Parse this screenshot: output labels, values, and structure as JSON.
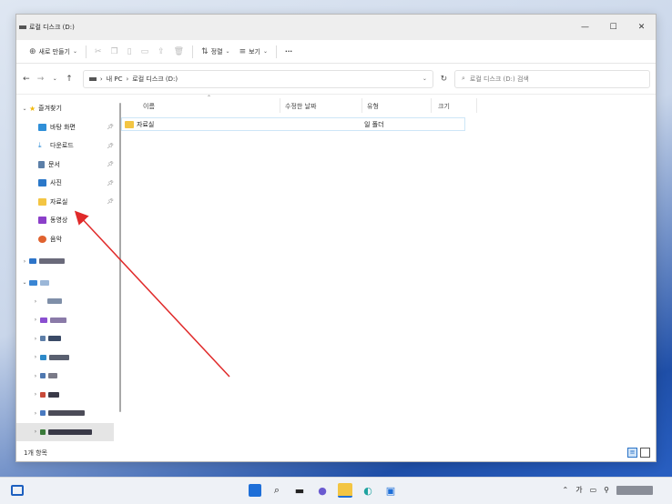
{
  "window": {
    "title": "로컬 디스크 (D:)",
    "controls": {
      "minimize": "—",
      "maximize": "☐",
      "close": "✕"
    }
  },
  "toolbar": {
    "new_label": "새로 만들기",
    "sort_label": "정렬",
    "view_label": "보기",
    "more_label": "···"
  },
  "address": {
    "path_root": "내 PC",
    "path_current": "로컬 디스크 (D:)",
    "search_placeholder": "로컬 디스크 (D:) 검색"
  },
  "sidebar": {
    "quick_access": "즐겨찾기",
    "items": [
      {
        "label": "바탕 화면",
        "icon": "desktop-icon",
        "color": "#2f8fd8"
      },
      {
        "label": "다운로드",
        "icon": "download-icon",
        "color": "#2a8ad6"
      },
      {
        "label": "문서",
        "icon": "documents-icon",
        "color": "#5c7fa8"
      },
      {
        "label": "사진",
        "icon": "pictures-icon",
        "color": "#2b78c9"
      },
      {
        "label": "자료실",
        "icon": "folder-icon",
        "color": "#f3c543"
      },
      {
        "label": "동영상",
        "icon": "videos-icon",
        "color": "#8b3fc9"
      },
      {
        "label": "음악",
        "icon": "music-icon",
        "color": "#e0622f"
      }
    ]
  },
  "columns": {
    "name": "이름",
    "modified": "수정한 날짜",
    "type": "유형",
    "size": "크기"
  },
  "files": [
    {
      "name": "자료실",
      "type": "일 폴더"
    }
  ],
  "status": {
    "item_count": "1개 항목"
  },
  "tray": {
    "lang": "가"
  }
}
